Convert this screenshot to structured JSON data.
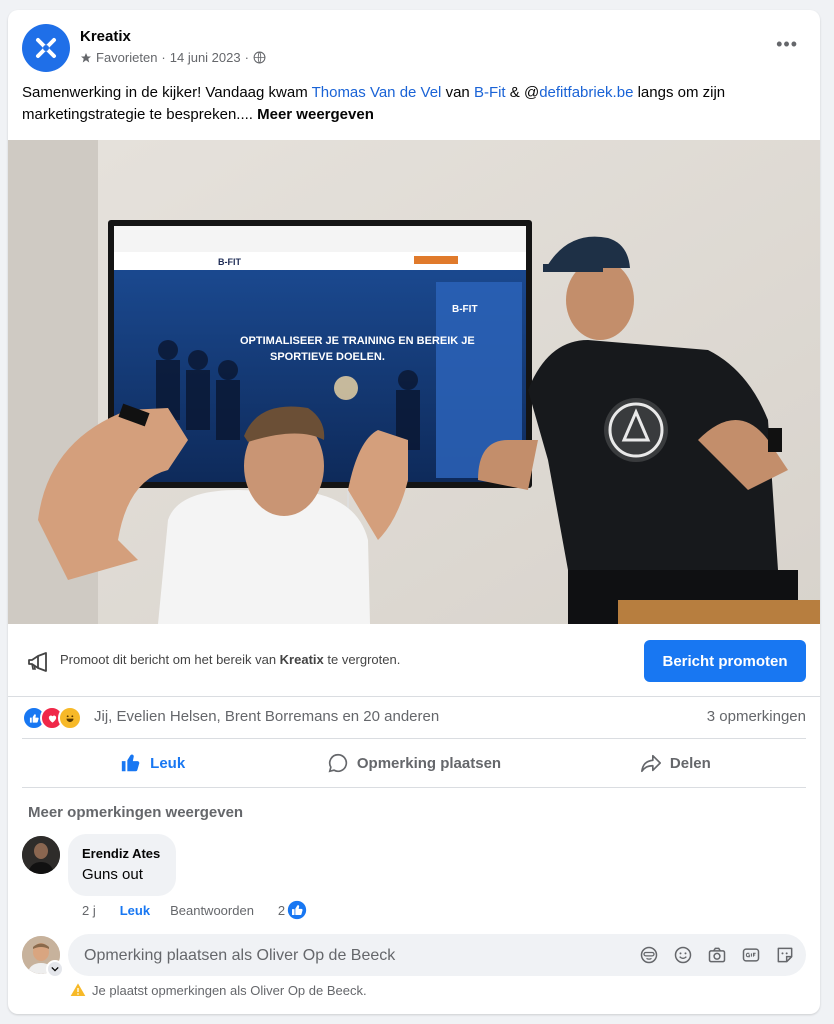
{
  "post": {
    "page_name": "Kreatix",
    "favorites": "Favorieten",
    "date": "14 juni 2023",
    "separator": "·",
    "more_options": "•••",
    "text_before": "Samenwerking in de kijker! Vandaag kwam ",
    "link1": "Thomas Van de Vel",
    "text_mid1": " van ",
    "link2": "B-Fit",
    "text_mid2": " & @",
    "link3": "defitfabriek.be",
    "text_after": " langs om zijn marketingstrategie te bespreken.... ",
    "see_more": "Meer weergeven"
  },
  "photo": {
    "screen_logo": "B-FIT",
    "screen_headline1": "OPTIMALISEER JE TRAINING EN BEREIK JE",
    "screen_headline2": "SPORTIEVE DOELEN.",
    "badge_text": "B-FIT"
  },
  "promote": {
    "text_before": "Promoot dit bericht om het bereik van ",
    "page": "Kreatix",
    "text_after": " te vergroten.",
    "button": "Bericht promoten"
  },
  "reactions": {
    "names": "Jij, Evelien Helsen, Brent Borremans en 20 anderen",
    "comments_count": "3 opmerkingen",
    "icons": [
      "like-icon",
      "love-icon",
      "haha-icon"
    ]
  },
  "actions": {
    "like": "Leuk",
    "comment": "Opmerking plaatsen",
    "share": "Delen"
  },
  "comments": {
    "more": "Meer opmerkingen weergeven",
    "items": [
      {
        "author": "Erendiz Ates",
        "text": "Guns out",
        "time": "2 j",
        "like": "Leuk",
        "reply": "Beantwoorden",
        "reaction_count": "2"
      }
    ]
  },
  "composer": {
    "placeholder": "Opmerking plaatsen als Oliver Op de Beeck",
    "warning": "Je plaatst opmerkingen als Oliver Op de Beeck."
  },
  "colors": {
    "accent": "#1877f2",
    "link": "#1a63d6",
    "muted": "#65676b"
  }
}
